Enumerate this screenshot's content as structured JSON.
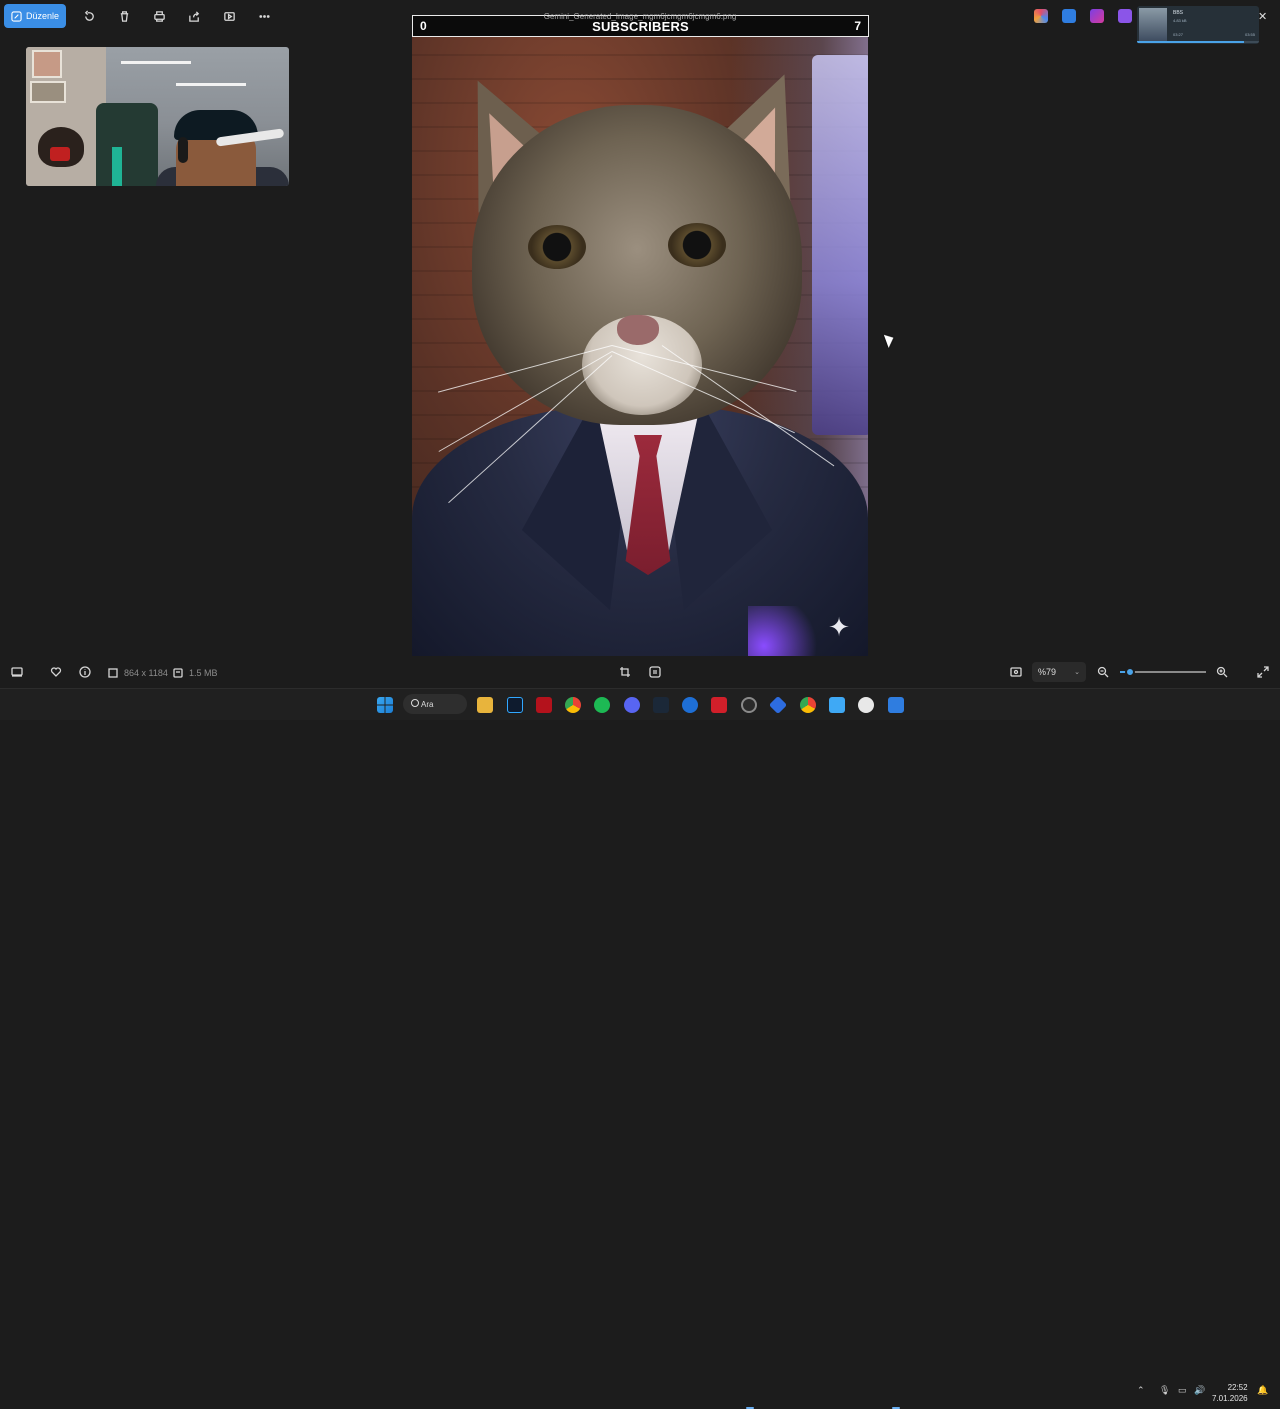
{
  "toolbar": {
    "edit_label": "Düzenle",
    "icons": [
      "rotate-icon",
      "delete-icon",
      "print-icon",
      "share-icon",
      "slideshow-icon",
      "more-icon"
    ]
  },
  "image": {
    "file_name": "Gemini_Generated_Image_mgm6jcmgm6jcmgm6.png",
    "overlay": {
      "left_value": "0",
      "title": "SUBSCRIBERS",
      "right_value": "7"
    }
  },
  "mini_player": {
    "title": "BBS",
    "subtitle": "4.83 kB",
    "time_current": "03:27",
    "time_total": "03:55",
    "progress": 0.88
  },
  "info_bar": {
    "dimensions": "864 x 1184",
    "size": "1.5 MB",
    "zoom": "%79",
    "zoom_fraction": 0.12
  },
  "taskbar": {
    "search_label": "Ara",
    "time": "22:52",
    "date": "7.01.2026"
  },
  "colors": {
    "accent": "#3a8ee6",
    "background": "#1c1c1c",
    "taskbar": "#202020"
  }
}
